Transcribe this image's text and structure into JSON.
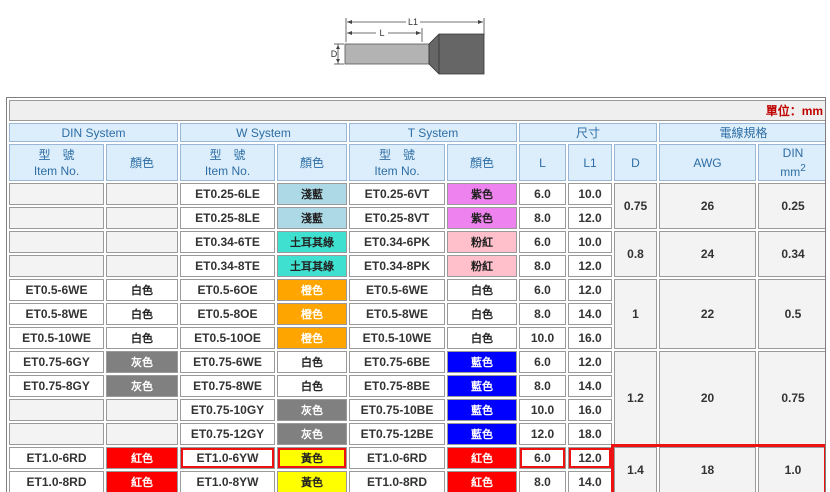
{
  "diagram": {
    "label_L1": "L1",
    "label_L": "L",
    "label_D": "D"
  },
  "unit": "單位：mm",
  "headers": {
    "din_system": "DIN System",
    "w_system": "W System",
    "t_system": "T System",
    "dimension": "尺寸",
    "wire_spec": "電線規格",
    "item_cn": "型　號",
    "item_en": "Item No.",
    "color": "顏色",
    "L": "L",
    "L1": "L1",
    "D": "D",
    "awg": "AWG",
    "din": "DIN",
    "din_unit": "mm",
    "din_unit_sup": "2"
  },
  "colors": {
    "light_blue": "#add8e6",
    "turquoise": "#40e0d0",
    "pink": "#ffc0cb",
    "violet": "#ee82ee",
    "white": "#ffffff",
    "orange": "#ffa500",
    "grey": "#808080",
    "blue": "#0000ff",
    "red": "#ff0000",
    "yellow": "#ffff00",
    "highlight": "#ee1111",
    "header_bg": "#dceefb",
    "header_text": "#2e6da4"
  },
  "rows": [
    {
      "din_item": "",
      "din_color": "",
      "w_item": "ET0.25-6LE",
      "w_color": "淺藍",
      "w_bg": "#add8e6",
      "w_fg": "#222222",
      "t_item": "ET0.25-6VT",
      "t_color": "紫色",
      "t_bg": "#ee82ee",
      "t_fg": "#222222",
      "L": "6.0",
      "L1": "10.0"
    },
    {
      "din_item": "",
      "din_color": "",
      "w_item": "ET0.25-8LE",
      "w_color": "淺藍",
      "w_bg": "#add8e6",
      "w_fg": "#222222",
      "t_item": "ET0.25-8VT",
      "t_color": "紫色",
      "t_bg": "#ee82ee",
      "t_fg": "#222222",
      "L": "8.0",
      "L1": "12.0"
    },
    {
      "din_item": "",
      "din_color": "",
      "w_item": "ET0.34-6TE",
      "w_color": "土耳其綠",
      "w_bg": "#40e0d0",
      "w_fg": "#222222",
      "t_item": "ET0.34-6PK",
      "t_color": "粉紅",
      "t_bg": "#ffc0cb",
      "t_fg": "#222222",
      "L": "6.0",
      "L1": "10.0"
    },
    {
      "din_item": "",
      "din_color": "",
      "w_item": "ET0.34-8TE",
      "w_color": "土耳其綠",
      "w_bg": "#40e0d0",
      "w_fg": "#222222",
      "t_item": "ET0.34-8PK",
      "t_color": "粉紅",
      "t_bg": "#ffc0cb",
      "t_fg": "#222222",
      "L": "8.0",
      "L1": "12.0"
    },
    {
      "din_item": "ET0.5-6WE",
      "din_color": "白色",
      "din_bg": "#ffffff",
      "din_fg": "#222222",
      "w_item": "ET0.5-6OE",
      "w_color": "橙色",
      "w_bg": "#ffa500",
      "w_fg": "#ffffff",
      "t_item": "ET0.5-6WE",
      "t_color": "白色",
      "t_bg": "#ffffff",
      "t_fg": "#222222",
      "L": "6.0",
      "L1": "12.0"
    },
    {
      "din_item": "ET0.5-8WE",
      "din_color": "白色",
      "din_bg": "#ffffff",
      "din_fg": "#222222",
      "w_item": "ET0.5-8OE",
      "w_color": "橙色",
      "w_bg": "#ffa500",
      "w_fg": "#ffffff",
      "t_item": "ET0.5-8WE",
      "t_color": "白色",
      "t_bg": "#ffffff",
      "t_fg": "#222222",
      "L": "8.0",
      "L1": "14.0"
    },
    {
      "din_item": "ET0.5-10WE",
      "din_color": "白色",
      "din_bg": "#ffffff",
      "din_fg": "#222222",
      "w_item": "ET0.5-10OE",
      "w_color": "橙色",
      "w_bg": "#ffa500",
      "w_fg": "#ffffff",
      "t_item": "ET0.5-10WE",
      "t_color": "白色",
      "t_bg": "#ffffff",
      "t_fg": "#222222",
      "L": "10.0",
      "L1": "16.0"
    },
    {
      "din_item": "ET0.75-6GY",
      "din_color": "灰色",
      "din_bg": "#808080",
      "din_fg": "#ffffff",
      "w_item": "ET0.75-6WE",
      "w_color": "白色",
      "w_bg": "#ffffff",
      "w_fg": "#222222",
      "t_item": "ET0.75-6BE",
      "t_color": "藍色",
      "t_bg": "#0000ff",
      "t_fg": "#ffffff",
      "L": "6.0",
      "L1": "12.0"
    },
    {
      "din_item": "ET0.75-8GY",
      "din_color": "灰色",
      "din_bg": "#808080",
      "din_fg": "#ffffff",
      "w_item": "ET0.75-8WE",
      "w_color": "白色",
      "w_bg": "#ffffff",
      "w_fg": "#222222",
      "t_item": "ET0.75-8BE",
      "t_color": "藍色",
      "t_bg": "#0000ff",
      "t_fg": "#ffffff",
      "L": "8.0",
      "L1": "14.0"
    },
    {
      "din_item": "",
      "din_color": "",
      "w_item": "ET0.75-10GY",
      "w_color": "灰色",
      "w_bg": "#808080",
      "w_fg": "#ffffff",
      "t_item": "ET0.75-10BE",
      "t_color": "藍色",
      "t_bg": "#0000ff",
      "t_fg": "#ffffff",
      "L": "10.0",
      "L1": "16.0"
    },
    {
      "din_item": "",
      "din_color": "",
      "w_item": "ET0.75-12GY",
      "w_color": "灰色",
      "w_bg": "#808080",
      "w_fg": "#ffffff",
      "t_item": "ET0.75-12BE",
      "t_color": "藍色",
      "t_bg": "#0000ff",
      "t_fg": "#ffffff",
      "L": "12.0",
      "L1": "18.0"
    },
    {
      "din_item": "ET1.0-6RD",
      "din_color": "紅色",
      "din_bg": "#ff0000",
      "din_fg": "#ffffff",
      "w_item": "ET1.0-6YW",
      "w_color": "黃色",
      "w_bg": "#ffff00",
      "w_fg": "#222222",
      "t_item": "ET1.0-6RD",
      "t_color": "紅色",
      "t_bg": "#ff0000",
      "t_fg": "#ffffff",
      "L": "6.0",
      "L1": "12.0"
    },
    {
      "din_item": "ET1.0-8RD",
      "din_color": "紅色",
      "din_bg": "#ff0000",
      "din_fg": "#ffffff",
      "w_item": "ET1.0-8YW",
      "w_color": "黃色",
      "w_bg": "#ffff00",
      "w_fg": "#222222",
      "t_item": "ET1.0-8RD",
      "t_color": "紅色",
      "t_bg": "#ff0000",
      "t_fg": "#ffffff",
      "L": "8.0",
      "L1": "14.0"
    }
  ],
  "groups": [
    {
      "D": "0.75",
      "AWG": "26",
      "DIN": "0.25"
    },
    {
      "D": "0.8",
      "AWG": "24",
      "DIN": "0.34"
    },
    {
      "D": "1",
      "AWG": "22",
      "DIN": "0.5"
    },
    {
      "D": "1.2",
      "AWG": "20",
      "DIN": "0.75"
    },
    {
      "D": "1.4",
      "AWG": "18",
      "DIN": "1.0"
    }
  ]
}
